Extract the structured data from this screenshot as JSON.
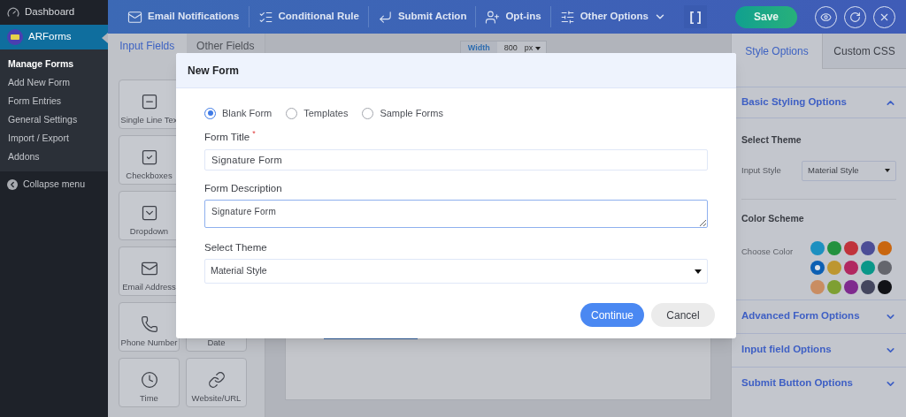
{
  "admin_menu": {
    "items": [
      {
        "label": "Dashboard",
        "selected": false
      },
      {
        "label": "ARForms",
        "selected": true
      }
    ],
    "submenu": [
      {
        "label": "Manage Forms",
        "selected": true
      },
      {
        "label": "Add New Form",
        "selected": false
      },
      {
        "label": "Form Entries",
        "selected": false
      },
      {
        "label": "General Settings",
        "selected": false
      },
      {
        "label": "Import / Export",
        "selected": false
      },
      {
        "label": "Addons",
        "selected": false
      }
    ],
    "collapse": "Collapse menu"
  },
  "toolbar": {
    "items": [
      {
        "label": "Email Notifications",
        "dropdown": false
      },
      {
        "label": "Conditional Rule",
        "dropdown": false
      },
      {
        "label": "Submit Action",
        "dropdown": false
      },
      {
        "label": "Opt-ins",
        "dropdown": false
      },
      {
        "label": "Other Options",
        "dropdown": true
      }
    ],
    "fullscreen": "[ ]",
    "save": "Save"
  },
  "fields_panel": {
    "tabs": [
      {
        "label": "Input Fields",
        "selected": true
      },
      {
        "label": "Other Fields",
        "selected": false
      }
    ],
    "column_1": [
      "Single Line Tex",
      "Checkboxes",
      "Dropdown",
      "Email Address",
      "Phone Number",
      "Time"
    ],
    "column_2": [
      "Date",
      "Website/URL"
    ]
  },
  "canvas": {
    "width_label": "Width",
    "width_value": "800",
    "unit": "px"
  },
  "style_panel": {
    "tabs": [
      {
        "label": "Style Options",
        "selected": true
      },
      {
        "label": "Custom CSS",
        "selected": false
      }
    ],
    "basic": {
      "title": "Basic Styling Options",
      "expanded": true,
      "select_theme": "Select Theme",
      "input_style_label": "Input Style",
      "input_style": "Material Style",
      "color_scheme": "Color Scheme",
      "choose_color": "Choose Color",
      "colors": [
        {
          "color": "#1d90c0",
          "selected": false
        },
        {
          "color": "#23913f",
          "selected": false
        },
        {
          "color": "#c0333b",
          "selected": false
        },
        {
          "color": "#4c4d96",
          "selected": false
        },
        {
          "color": "#c9660f",
          "selected": false
        },
        {
          "color": "#0c5fb3",
          "selected": true
        },
        {
          "color": "#bd9630",
          "selected": false
        },
        {
          "color": "#b12861",
          "selected": false
        },
        {
          "color": "#0a9789",
          "selected": false
        },
        {
          "color": "#64666d",
          "selected": false
        },
        {
          "color": "#c98d62",
          "selected": false
        },
        {
          "color": "#7e9f33",
          "selected": false
        },
        {
          "color": "#7f2a8e",
          "selected": false
        },
        {
          "color": "#44465e",
          "selected": false
        },
        {
          "color": "#111216",
          "selected": false
        }
      ]
    },
    "sections": [
      {
        "title": "Advanced Form Options",
        "expanded": false
      },
      {
        "title": "Input field Options",
        "expanded": false
      },
      {
        "title": "Submit Button Options",
        "expanded": false
      }
    ]
  },
  "dialog": {
    "title": "New Form",
    "options": [
      {
        "label": "Blank Form",
        "selected": true
      },
      {
        "label": "Templates",
        "selected": false
      },
      {
        "label": "Sample Forms",
        "selected": false
      }
    ],
    "form_title_label": "Form Title",
    "required_mark": "*",
    "form_title": "Signature Form",
    "description_label": "Form Description",
    "description": "Signature Form",
    "theme_label": "Select Theme",
    "theme": "Material Style",
    "buttons": [
      {
        "label": "Continue",
        "kind": "primary"
      },
      {
        "label": "Cancel",
        "kind": "secondary"
      }
    ]
  }
}
